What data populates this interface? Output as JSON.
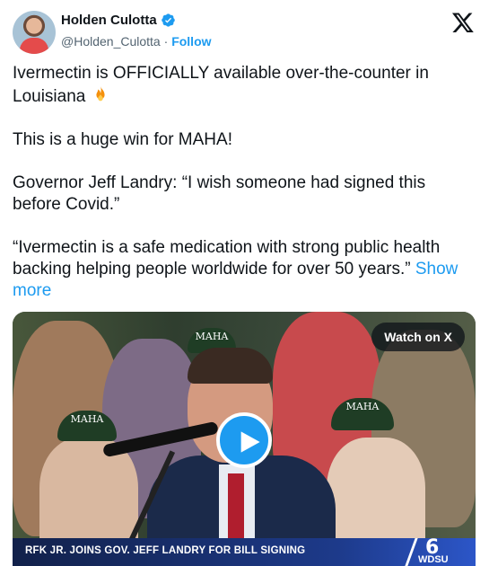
{
  "author": {
    "display_name": "Holden Culotta",
    "handle": "@Holden_Culotta",
    "separator": "·",
    "follow_label": "Follow",
    "verified": true
  },
  "icons": {
    "verified": "verified-badge-icon",
    "platform": "x-logo-icon",
    "emoji": "fire-icon",
    "play": "play-icon"
  },
  "tweet": {
    "line1": "Ivermectin is OFFICIALLY available over-the-counter in Louisiana",
    "line2": "This is a huge win for MAHA!",
    "line3": "Governor Jeff Landry: “I wish someone had signed this before Covid.”",
    "line4": "“Ivermectin is a safe medication with strong public health backing helping people worldwide for over 50 years.”",
    "show_more": "Show more"
  },
  "video": {
    "watch_label": "Watch on X",
    "banner_text": "RFK JR. JOINS GOV. JEFF LANDRY FOR BILL SIGNING",
    "station_number": "6",
    "station_name": "WDSU",
    "hat_text": "MAHA"
  },
  "colors": {
    "accent": "#1d9bf0",
    "text": "#0f1419",
    "muted": "#536471"
  }
}
